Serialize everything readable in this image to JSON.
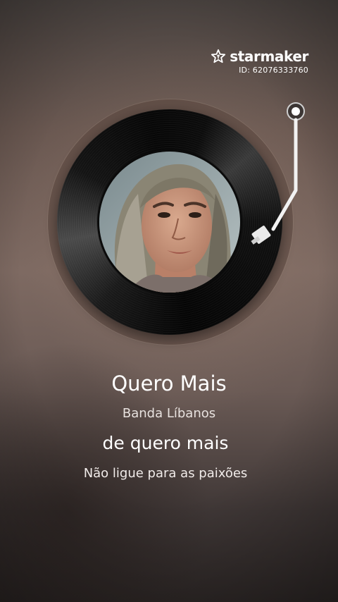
{
  "brand": {
    "name": "starmaker",
    "icon": "starmaker-star-icon"
  },
  "user": {
    "id_text": "ID: 62076333760"
  },
  "player": {
    "record_icon": "vinyl-record",
    "tonearm_icon": "tonearm",
    "avatar": "singer-avatar"
  },
  "song": {
    "title": "Quero Mais",
    "artist": "Banda Líbanos"
  },
  "lyrics": {
    "current": "de quero mais",
    "next": "Não ligue para as paixões"
  }
}
